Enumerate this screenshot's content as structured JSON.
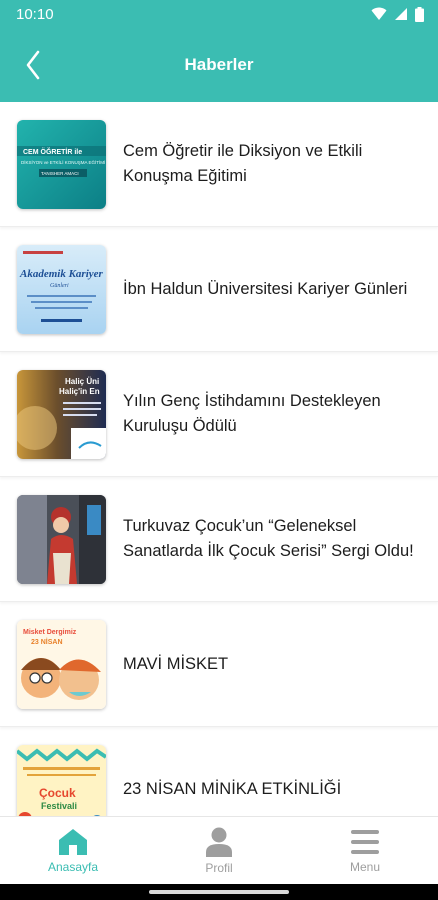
{
  "status_bar": {
    "time": "10:10",
    "icons": [
      "wifi-icon",
      "cellular-icon",
      "battery-icon"
    ]
  },
  "header": {
    "title": "Haberler",
    "back_icon": "chevron-left-icon"
  },
  "colors": {
    "primary": "#3bbdb2",
    "text": "#1d1d1d",
    "inactive": "#9e9e9e"
  },
  "news": [
    {
      "title": "Cem Öğretir ile Diksiyon ve Etkili Konuşma Eğitimi",
      "thumb_lines": [
        "CEM ÖĞRETİR ile",
        "DİKSİYON ve ETKİLİ KONUŞMA EĞİTİMİ",
        "TANISHER AMACI"
      ]
    },
    {
      "title": "İbn Haldun Üniversitesi Kariyer Günleri",
      "thumb_lines": [
        "Akademik Kariyer",
        "Günleri"
      ]
    },
    {
      "title": "Yılın Genç İstihdamını Destekleyen Kuruluşu Ödülü",
      "thumb_lines": [
        "Haliç Üni",
        "Haliç'in En"
      ]
    },
    {
      "title": "Turkuvaz Çocuk’un “Geleneksel Sanatlarda İlk Çocuk Serisi” Sergi Oldu!",
      "thumb_lines": []
    },
    {
      "title": "MAVİ MİSKET",
      "thumb_lines": [
        "Misket Dergimiz",
        "23 NİSAN"
      ]
    },
    {
      "title": "23 NİSAN MİNİKA ETKİNLİĞİ",
      "thumb_lines": [
        "Çocuk",
        "Festivali"
      ]
    }
  ],
  "bottom_nav": [
    {
      "label": "Anasayfa",
      "icon": "home-icon",
      "active": true
    },
    {
      "label": "Profil",
      "icon": "user-icon",
      "active": false
    },
    {
      "label": "Menu",
      "icon": "menu-icon",
      "active": false
    }
  ]
}
